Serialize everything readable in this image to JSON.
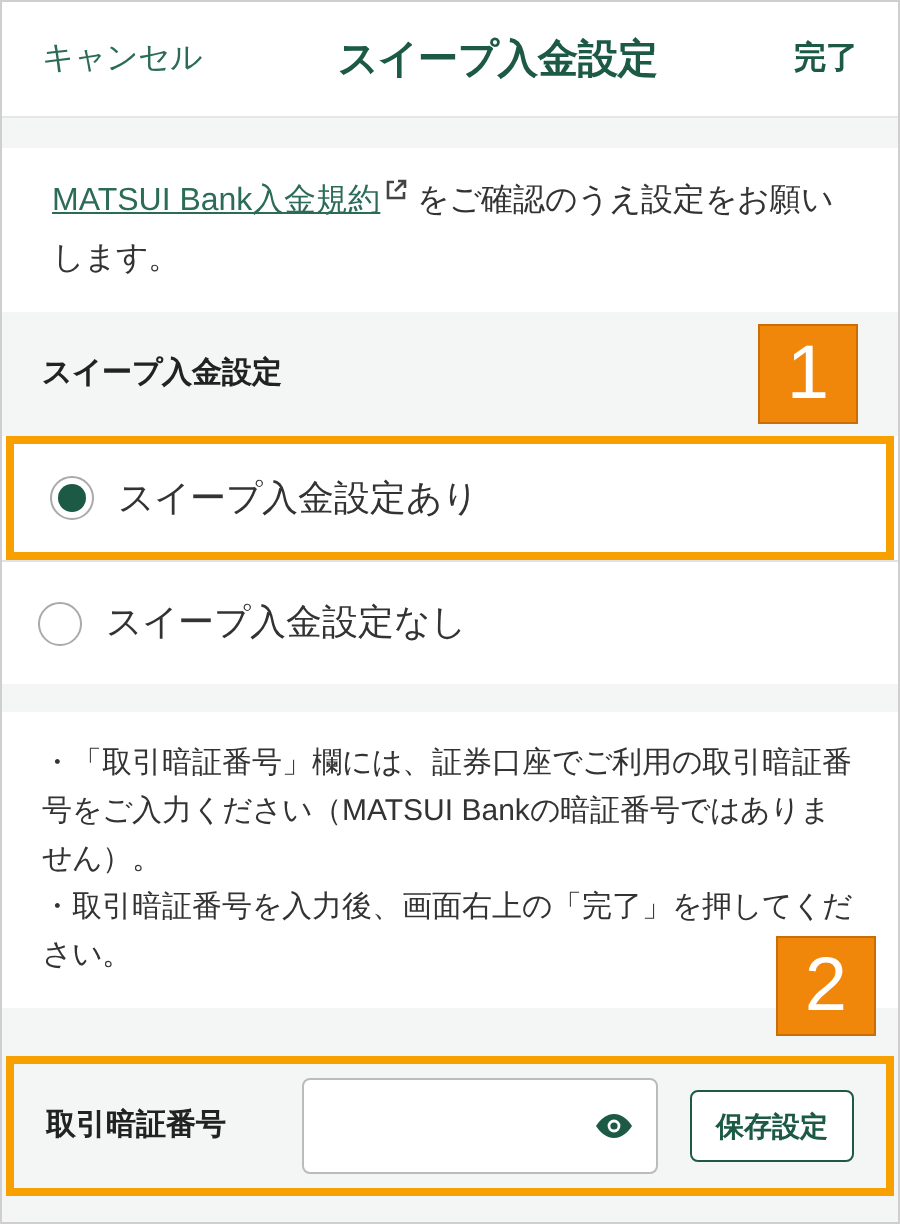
{
  "header": {
    "cancel": "キャンセル",
    "title": "スイープ入金設定",
    "done": "完了"
  },
  "intro": {
    "link": "MATSUI Bank入金規約",
    "text": "をご確認のうえ設定をお願いします。"
  },
  "section": {
    "title": "スイープ入金設定",
    "callout": "1"
  },
  "options": [
    {
      "label": "スイープ入金設定あり",
      "selected": true,
      "highlighted": true
    },
    {
      "label": "スイープ入金設定なし",
      "selected": false,
      "highlighted": false
    }
  ],
  "notes": [
    "・「取引暗証番号」欄には、証券口座でご利用の取引暗証番号をご入力ください（MATSUI Bankの暗証番号ではありません）。",
    "・取引暗証番号を入力後、画面右上の「完了」を押してください。"
  ],
  "pin": {
    "callout": "2",
    "label": "取引暗証番号",
    "button": "保存設定"
  }
}
